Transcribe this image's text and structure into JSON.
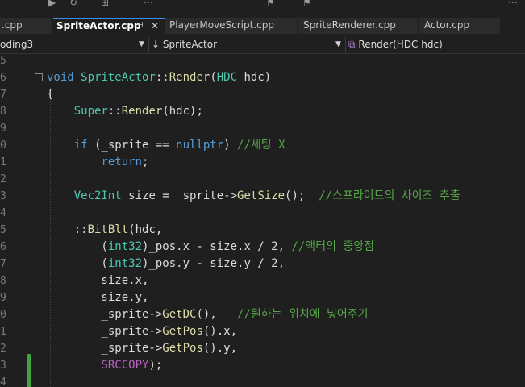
{
  "tabs": [
    {
      "label": ".cpp",
      "active": false
    },
    {
      "label": "SpriteActor.cpp",
      "active": true
    },
    {
      "label": "PlayerMoveScript.cpp",
      "active": false
    },
    {
      "label": "SpriteRenderer.cpp",
      "active": false
    },
    {
      "label": "Actor.cpp",
      "active": false
    }
  ],
  "tab_pin_glyph": "⊣",
  "tab_close_glyph": "✕",
  "navbar": {
    "project": "oding3",
    "scope": "↓ SpriteActor",
    "member": "Render(HDC hdc)"
  },
  "colors": {
    "accent": "#3a8ee6",
    "change_marker": "#3fa33f",
    "keyword": "#569cd6",
    "type": "#4ec9b0",
    "function": "#dcdcaa",
    "comment": "#57a64a",
    "macro": "#bd63c5"
  },
  "lines": [
    {
      "num": "5",
      "tokens": []
    },
    {
      "num": "6",
      "tokens": [
        [
          "kw",
          "void "
        ],
        [
          "cls",
          "SpriteActor"
        ],
        [
          "",
          "::"
        ],
        [
          "fn",
          "Render"
        ],
        [
          "",
          "("
        ],
        [
          "cls",
          "HDC"
        ],
        [
          "",
          " hdc)"
        ]
      ]
    },
    {
      "num": "7",
      "tokens": [
        [
          "",
          "{"
        ]
      ]
    },
    {
      "num": "8",
      "tokens": [
        [
          "",
          "    "
        ],
        [
          "cls",
          "Super"
        ],
        [
          "",
          "::"
        ],
        [
          "fn",
          "Render"
        ],
        [
          "",
          "(hdc);"
        ]
      ]
    },
    {
      "num": "9",
      "tokens": []
    },
    {
      "num": "0",
      "tokens": [
        [
          "",
          "    "
        ],
        [
          "kw",
          "if"
        ],
        [
          "",
          " (_sprite == "
        ],
        [
          "kw",
          "nullptr"
        ],
        [
          "",
          ") "
        ],
        [
          "cm",
          "//세팅 X"
        ]
      ]
    },
    {
      "num": "1",
      "tokens": [
        [
          "",
          "        "
        ],
        [
          "kw",
          "return"
        ],
        [
          "",
          ";"
        ]
      ]
    },
    {
      "num": "2",
      "tokens": []
    },
    {
      "num": "3",
      "tokens": [
        [
          "",
          "    "
        ],
        [
          "cls",
          "Vec2Int"
        ],
        [
          "",
          " size = _sprite->"
        ],
        [
          "fn",
          "GetSize"
        ],
        [
          "",
          "();  "
        ],
        [
          "cm",
          "//스프라이트의 사이즈 추출"
        ]
      ]
    },
    {
      "num": "4",
      "tokens": []
    },
    {
      "num": "5",
      "tokens": [
        [
          "",
          "    ::"
        ],
        [
          "fn",
          "BitBlt"
        ],
        [
          "",
          "(hdc,"
        ]
      ]
    },
    {
      "num": "6",
      "tokens": [
        [
          "",
          "        ("
        ],
        [
          "cls",
          "int32"
        ],
        [
          "",
          ")_pos.x - size.x / 2, "
        ],
        [
          "cm",
          "//액터의 중앙점"
        ]
      ]
    },
    {
      "num": "7",
      "tokens": [
        [
          "",
          "        ("
        ],
        [
          "cls",
          "int32"
        ],
        [
          "",
          ")_pos.y - size.y / 2,"
        ]
      ]
    },
    {
      "num": "8",
      "tokens": [
        [
          "",
          "        size.x,"
        ]
      ]
    },
    {
      "num": "9",
      "tokens": [
        [
          "",
          "        size.y,"
        ]
      ]
    },
    {
      "num": "0",
      "tokens": [
        [
          "",
          "        _sprite->"
        ],
        [
          "fn",
          "GetDC"
        ],
        [
          "",
          "(),   "
        ],
        [
          "cm",
          "//원하는 위치에 넣어주기"
        ]
      ]
    },
    {
      "num": "1",
      "tokens": [
        [
          "",
          "        _sprite->"
        ],
        [
          "fn",
          "GetPos"
        ],
        [
          "",
          "().x,"
        ]
      ]
    },
    {
      "num": "2",
      "tokens": [
        [
          "",
          "        _sprite->"
        ],
        [
          "fn",
          "GetPos"
        ],
        [
          "",
          "().y,"
        ]
      ]
    },
    {
      "num": "3",
      "tokens": [
        [
          "",
          "        "
        ],
        [
          "mac",
          "SRCCOPY"
        ],
        [
          "",
          ");"
        ]
      ]
    },
    {
      "num": "4",
      "tokens": []
    }
  ]
}
